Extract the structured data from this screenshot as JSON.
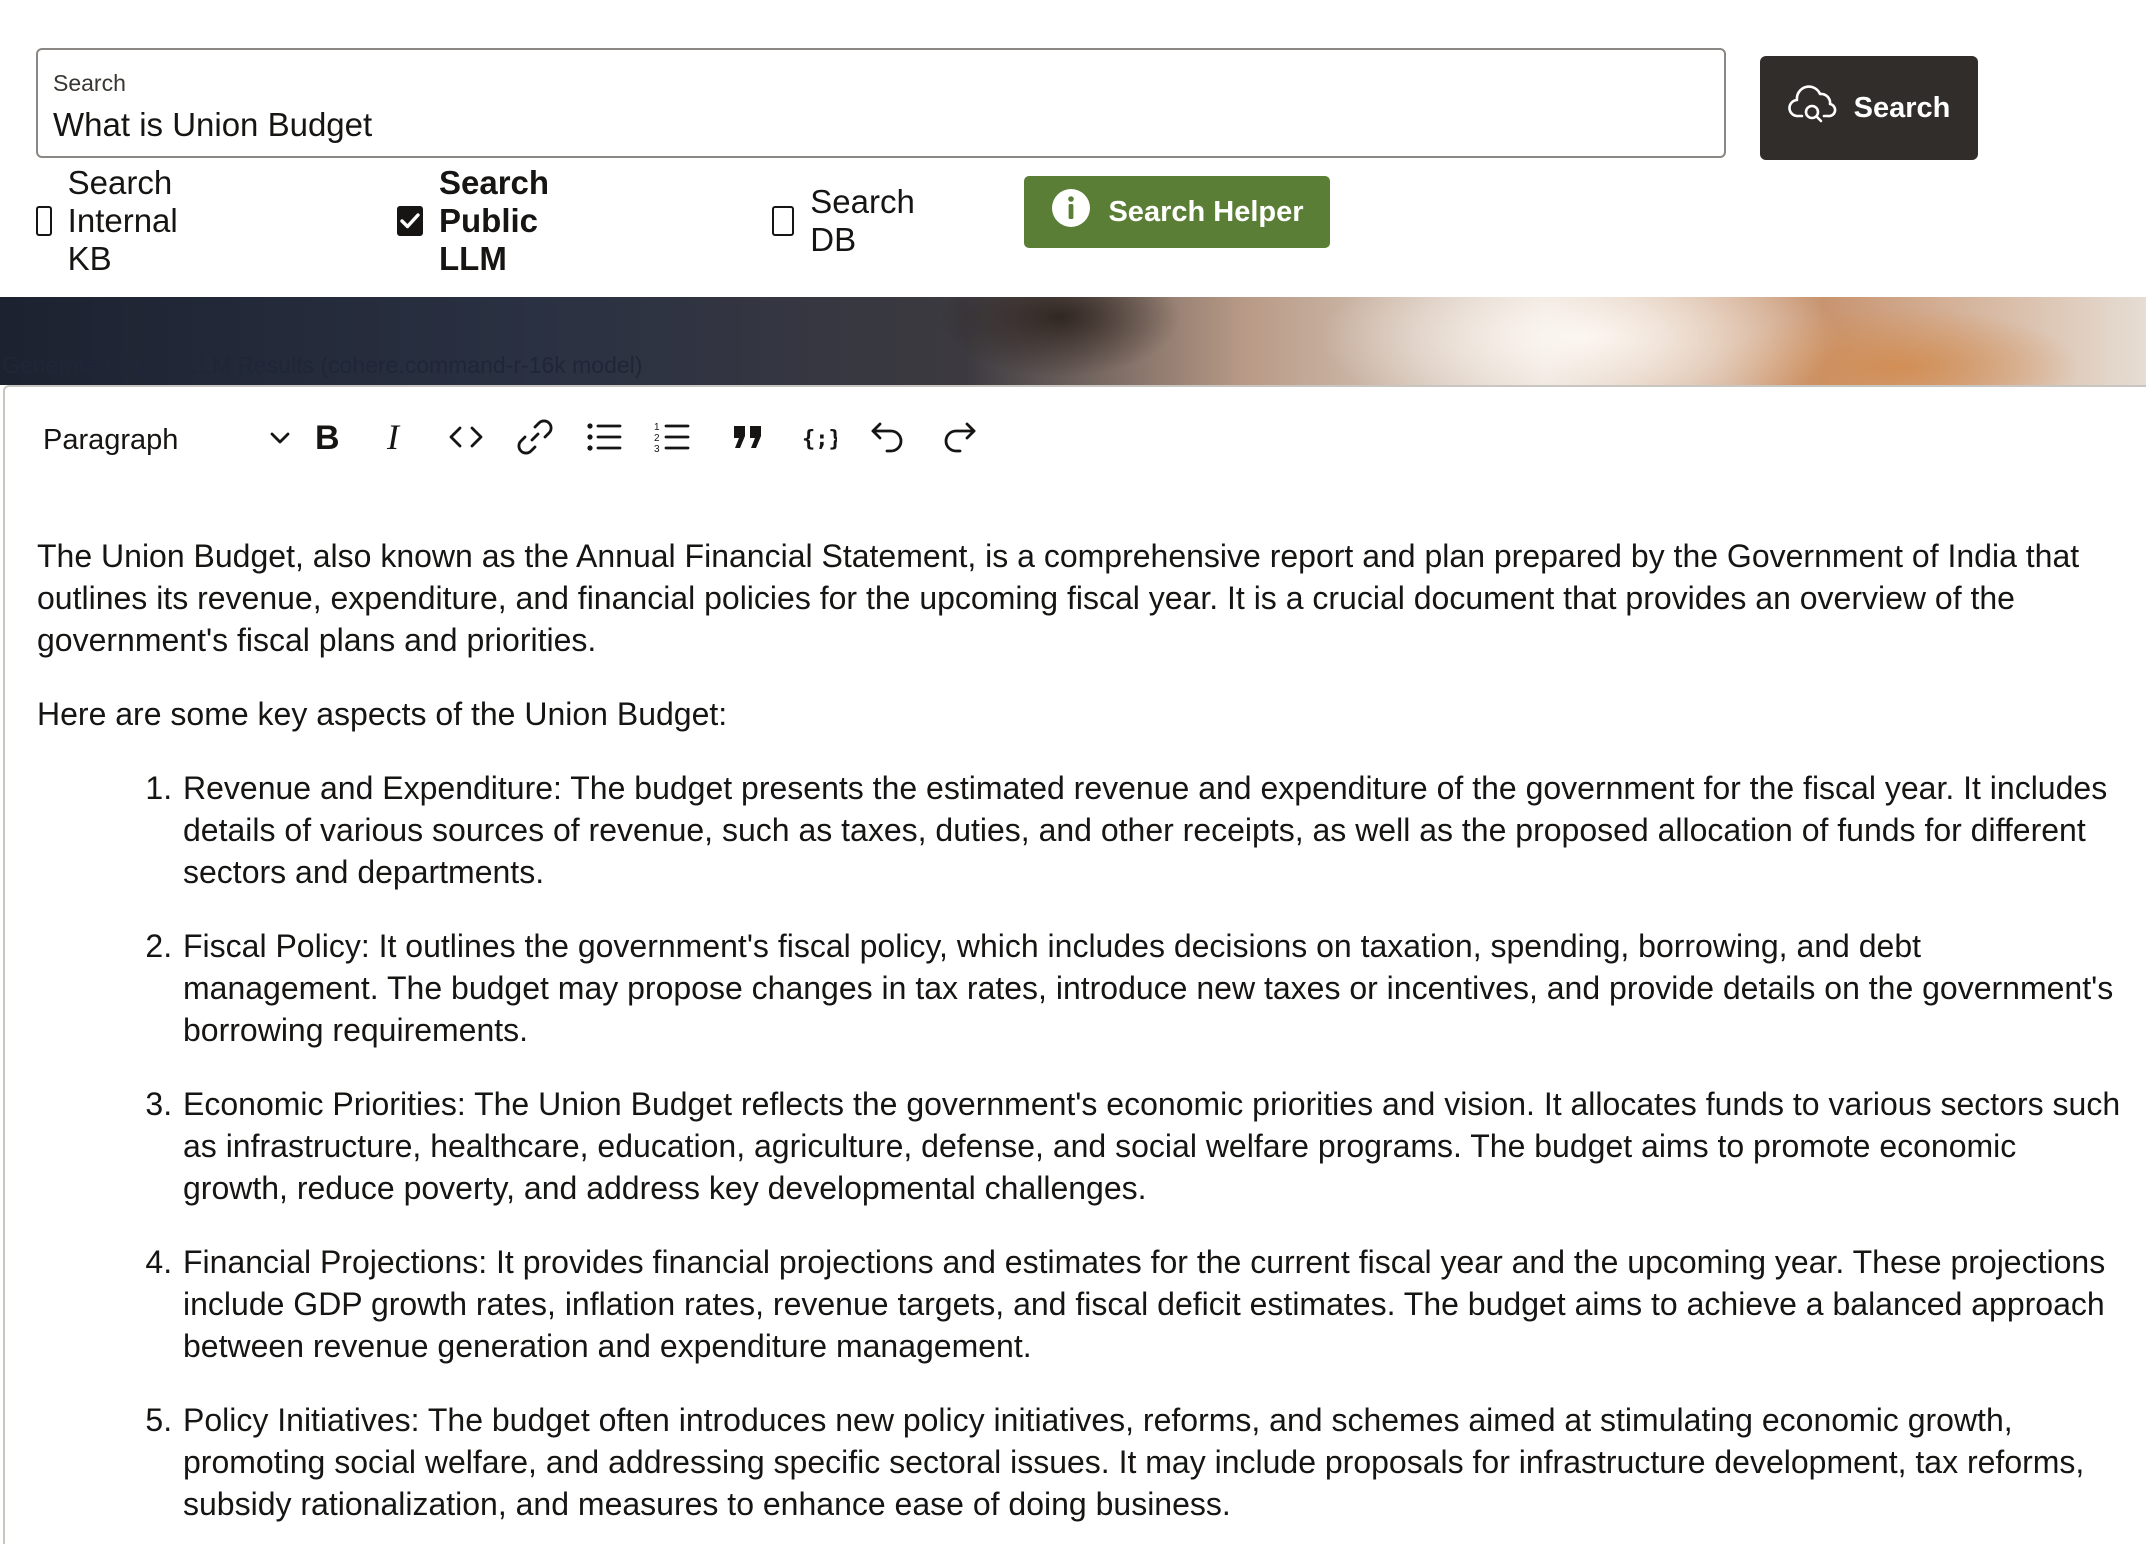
{
  "search": {
    "label": "Search",
    "value": "What is Union Budget",
    "button_label": "Search"
  },
  "options": {
    "internal_kb": {
      "label": "Search Internal KB",
      "checked": false
    },
    "public_llm": {
      "label": "Search Public LLM",
      "checked": true
    },
    "db": {
      "label": "Search DB",
      "checked": false
    }
  },
  "helper": {
    "label": "Search Helper"
  },
  "banner": {
    "caption": "Generated Public LLM Results (cohere.command-r-16k model)"
  },
  "editor": {
    "block_format": "Paragraph",
    "toolbar_icons": [
      "bold-icon",
      "italic-icon",
      "code-icon",
      "link-icon",
      "bullet-list-icon",
      "numbered-list-icon",
      "blockquote-icon",
      "code-block-icon",
      "undo-icon",
      "redo-icon"
    ],
    "intro": "The Union Budget, also known as the Annual Financial Statement, is a comprehensive report and plan prepared by the Government of India that outlines its revenue, expenditure, and financial policies for the upcoming fiscal year. It is a crucial document that provides an overview of the government's fiscal plans and priorities.",
    "lead": "Here are some key aspects of the Union Budget:",
    "items": [
      "Revenue and Expenditure: The budget presents the estimated revenue and expenditure of the government for the fiscal year. It includes details of various sources of revenue, such as taxes, duties, and other receipts, as well as the proposed allocation of funds for different sectors and departments.",
      "Fiscal Policy: It outlines the government's fiscal policy, which includes decisions on taxation, spending, borrowing, and debt management. The budget may propose changes in tax rates, introduce new taxes or incentives, and provide details on the government's borrowing requirements.",
      "Economic Priorities: The Union Budget reflects the government's economic priorities and vision. It allocates funds to various sectors such as infrastructure, healthcare, education, agriculture, defense, and social welfare programs. The budget aims to promote economic growth, reduce poverty, and address key developmental challenges.",
      "Financial Projections: It provides financial projections and estimates for the current fiscal year and the upcoming year. These projections include GDP growth rates, inflation rates, revenue targets, and fiscal deficit estimates. The budget aims to achieve a balanced approach between revenue generation and expenditure management.",
      "Policy Initiatives: The budget often introduces new policy initiatives, reforms, and schemes aimed at stimulating economic growth, promoting social welfare, and addressing specific sectoral issues. It may include proposals for infrastructure development, tax reforms, subsidy rationalization, and measures to enhance ease of doing business."
    ]
  },
  "colors": {
    "search_button": "#312d2a",
    "helper_button": "#5a7e35",
    "text": "#161513"
  }
}
